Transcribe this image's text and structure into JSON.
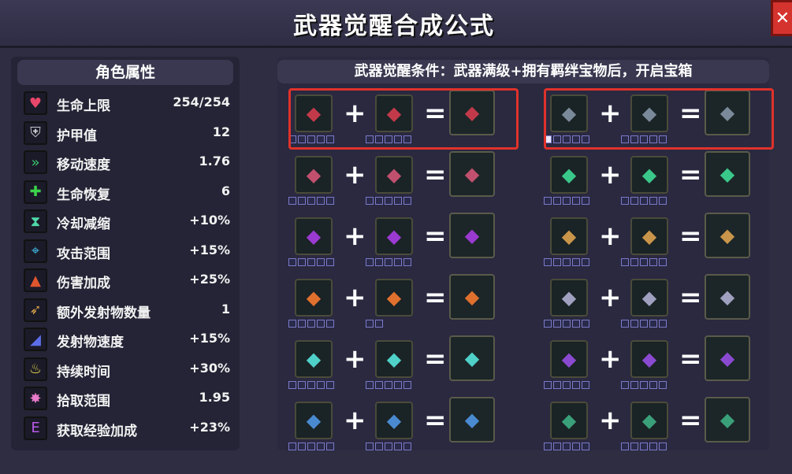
{
  "title": "武器觉醒合成公式",
  "close_label": "✕",
  "stats_header": "角色属性",
  "stats": [
    {
      "name": "生命上限",
      "value": "254/254",
      "icon": "heart-icon",
      "color": "#e8466a"
    },
    {
      "name": "护甲值",
      "value": "12",
      "icon": "armor-icon",
      "color": "#c8c8d0"
    },
    {
      "name": "移动速度",
      "value": "1.76",
      "icon": "boot-icon",
      "color": "#3ac770"
    },
    {
      "name": "生命恢复",
      "value": "6",
      "icon": "plus-icon",
      "color": "#3bd24a"
    },
    {
      "name": "冷却减缩",
      "value": "+10%",
      "icon": "hourglass-icon",
      "color": "#4fd9a8"
    },
    {
      "name": "攻击范围",
      "value": "+15%",
      "icon": "target-icon",
      "color": "#3fb8e0"
    },
    {
      "name": "伤害加成",
      "value": "+25%",
      "icon": "flame-icon",
      "color": "#e0552e"
    },
    {
      "name": "额外发射物数量",
      "value": "1",
      "icon": "arrows-icon",
      "color": "#d9a44a"
    },
    {
      "name": "发射物速度",
      "value": "+15%",
      "icon": "speed-icon",
      "color": "#5b6de8"
    },
    {
      "name": "持续时间",
      "value": "+30%",
      "icon": "torch-icon",
      "color": "#e8d64a"
    },
    {
      "name": "拾取范围",
      "value": "1.95",
      "icon": "magnet-icon",
      "color": "#e87acb"
    },
    {
      "name": "获取经验加成",
      "value": "+23%",
      "icon": "exp-icon",
      "color": "#b85be8"
    }
  ],
  "conditions_header": "武器觉醒条件：武器满级+拥有羁绊宝物后，开启宝箱",
  "op_plus": "+",
  "op_equals": "=",
  "recipes": [
    {
      "weapon": "crystal-shard-icon",
      "item": "knight-helmet-icon",
      "result": "awakened-crest-icon",
      "weapon_pips": 5,
      "item_pips": 5,
      "weapon_filled": 0,
      "highlight": true
    },
    {
      "weapon": "spectral-orb-icon",
      "item": "amulet-icon",
      "result": "awakened-wings-icon",
      "weapon_pips": 5,
      "item_pips": 5,
      "weapon_filled": 1,
      "highlight": true
    },
    {
      "weapon": "dark-bow-icon",
      "item": "golden-helmet-icon",
      "result": "awakened-bow-icon",
      "weapon_pips": 5,
      "item_pips": 5,
      "weapon_filled": 0,
      "highlight": false
    },
    {
      "weapon": "vine-leaf-icon",
      "item": "blue-cloak-icon",
      "result": "awakened-vines-icon",
      "weapon_pips": 5,
      "item_pips": 5,
      "weapon_filled": 0,
      "highlight": false
    },
    {
      "weapon": "purple-spear-icon",
      "item": "bat-mask-icon",
      "result": "awakened-spear-icon",
      "weapon_pips": 5,
      "item_pips": 5,
      "weapon_filled": 0,
      "highlight": false
    },
    {
      "weapon": "skull-totem-icon",
      "item": "hook-ring-icon",
      "result": "awakened-totem-icon",
      "weapon_pips": 5,
      "item_pips": 5,
      "weapon_filled": 0,
      "highlight": false
    },
    {
      "weapon": "fire-staff-icon",
      "item": "stone-idol-icon",
      "result": "awakened-fire-icon",
      "weapon_pips": 5,
      "item_pips": 2,
      "weapon_filled": 0,
      "highlight": false
    },
    {
      "weapon": "ember-rod-icon",
      "item": "shadow-cat-icon",
      "result": "awakened-rod-icon",
      "weapon_pips": 5,
      "item_pips": 5,
      "weapon_filled": 0,
      "highlight": false
    },
    {
      "weapon": "lantern-icon",
      "item": "ice-armor-icon",
      "result": "awakened-lantern-icon",
      "weapon_pips": 5,
      "item_pips": 5,
      "weapon_filled": 0,
      "highlight": false
    },
    {
      "weapon": "bat-wings-icon",
      "item": "wolf-icon",
      "result": "awakened-bat-icon",
      "weapon_pips": 5,
      "item_pips": 5,
      "weapon_filled": 0,
      "highlight": false
    },
    {
      "weapon": "fish-blade-icon",
      "item": "swirl-pendant-icon",
      "result": "awakened-blade-icon",
      "weapon_pips": 5,
      "item_pips": 5,
      "weapon_filled": 0,
      "highlight": false
    },
    {
      "weapon": "serpent-scroll-icon",
      "item": "orb-relic-icon",
      "result": "awakened-scroll-icon",
      "weapon_pips": 5,
      "item_pips": 5,
      "weapon_filled": 0,
      "highlight": false
    }
  ]
}
